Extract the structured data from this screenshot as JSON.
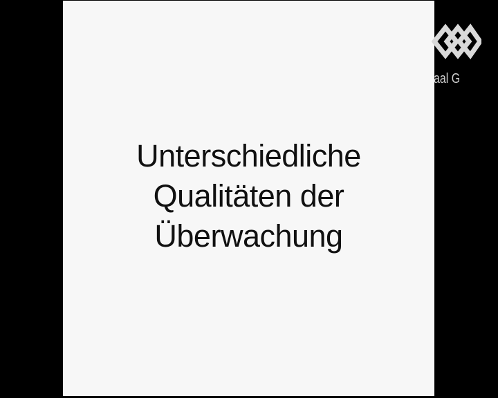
{
  "slide": {
    "lines": [
      "Unterschiedliche",
      "Qualitäten der",
      "Überwachung"
    ]
  },
  "channel": {
    "logo_icon": "diamond-chain-logo-icon",
    "label": "aal G"
  },
  "colors": {
    "background": "#000000",
    "slide": "#f7f7f7",
    "text": "#111111",
    "logo": "#d9d9d9"
  }
}
